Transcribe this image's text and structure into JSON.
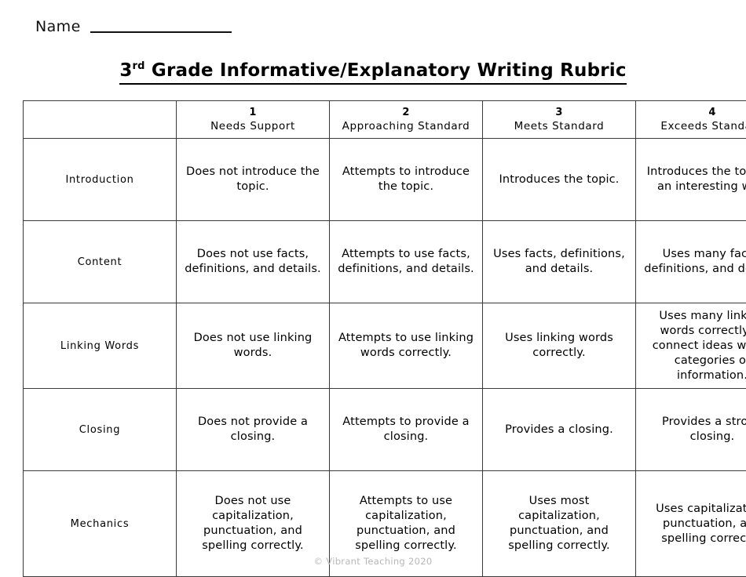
{
  "page": {
    "name_label": "Name",
    "title_prefix": "3",
    "title_sup": "rd",
    "title_rest": " Grade Informative/Explanatory Writing Rubric",
    "footer": "© Vibrant Teaching 2020"
  },
  "table": {
    "corner_label": "",
    "columns": [
      {
        "number": "1",
        "label": "Needs Support"
      },
      {
        "number": "2",
        "label": "Approaching Standard"
      },
      {
        "number": "3",
        "label": "Meets Standard"
      },
      {
        "number": "4",
        "label": "Exceeds Standard"
      }
    ],
    "rows": [
      {
        "criterion": "Introduction",
        "cells": [
          "Does not introduce the topic.",
          "Attempts to introduce the topic.",
          "Introduces the topic.",
          "Introduces the topic in an interesting way."
        ]
      },
      {
        "criterion": "Content",
        "cells": [
          "Does not use facts, definitions, and details.",
          "Attempts to use facts, definitions, and details.",
          "Uses facts, definitions, and details.",
          "Uses many facts, definitions, and details."
        ]
      },
      {
        "criterion": "Linking Words",
        "cells": [
          "Does not use linking words.",
          "Attempts to use linking words correctly.",
          "Uses linking words correctly.",
          "Uses many linking words correctly to connect ideas within categories of information."
        ]
      },
      {
        "criterion": "Closing",
        "cells": [
          "Does not provide a closing.",
          "Attempts to provide a closing.",
          "Provides a closing.",
          "Provides a strong closing."
        ]
      },
      {
        "criterion": "Mechanics",
        "cells": [
          "Does not use capitalization, punctuation, and spelling correctly.",
          "Attempts to use capitalization, punctuation, and spelling correctly.",
          "Uses most capitalization, punctuation, and spelling correctly.",
          "Uses capitalization, punctuation, and spelling correctly."
        ]
      }
    ]
  }
}
